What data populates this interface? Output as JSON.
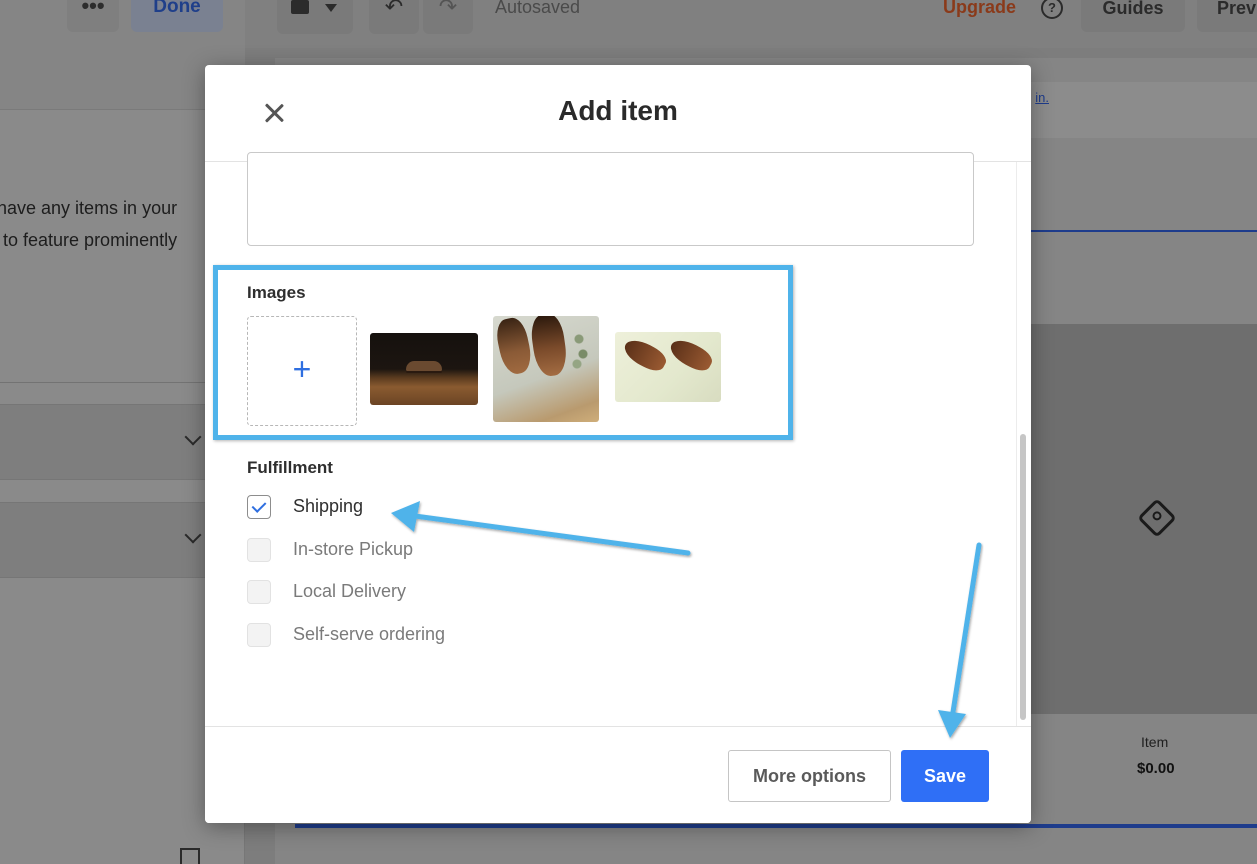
{
  "background": {
    "sidebar": {
      "more_label": "•••",
      "done_label": "Done",
      "message_line1": "nave any items in your",
      "message_line2": "to feature prominently"
    },
    "toolbar": {
      "undo_glyph": "↶",
      "redo_glyph": "↷",
      "autosaved": "Autosaved",
      "upgrade": "Upgrade",
      "help_glyph": "?",
      "guides": "Guides",
      "preview": "Preview"
    },
    "canvas": {
      "banner_link": "in.",
      "item_label": "Item",
      "item_price": "$0.00"
    }
  },
  "modal": {
    "title": "Add item",
    "images": {
      "label": "Images",
      "add_glyph": "+",
      "photos": [
        "shoe-photo-dark",
        "shoe-photo-overhead",
        "shoe-photo-light"
      ]
    },
    "fulfillment": {
      "label": "Fulfillment",
      "options": [
        {
          "label": "Shipping",
          "checked": true
        },
        {
          "label": "In-store Pickup",
          "checked": false
        },
        {
          "label": "Local Delivery",
          "checked": false
        },
        {
          "label": "Self-serve ordering",
          "checked": false
        }
      ]
    },
    "footer": {
      "more_options": "More options",
      "save": "Save"
    }
  },
  "colors": {
    "accent_blue": "#2f6ff6",
    "annotation_blue": "#4fb3ea",
    "upgrade_orange": "#8a3a1a"
  }
}
